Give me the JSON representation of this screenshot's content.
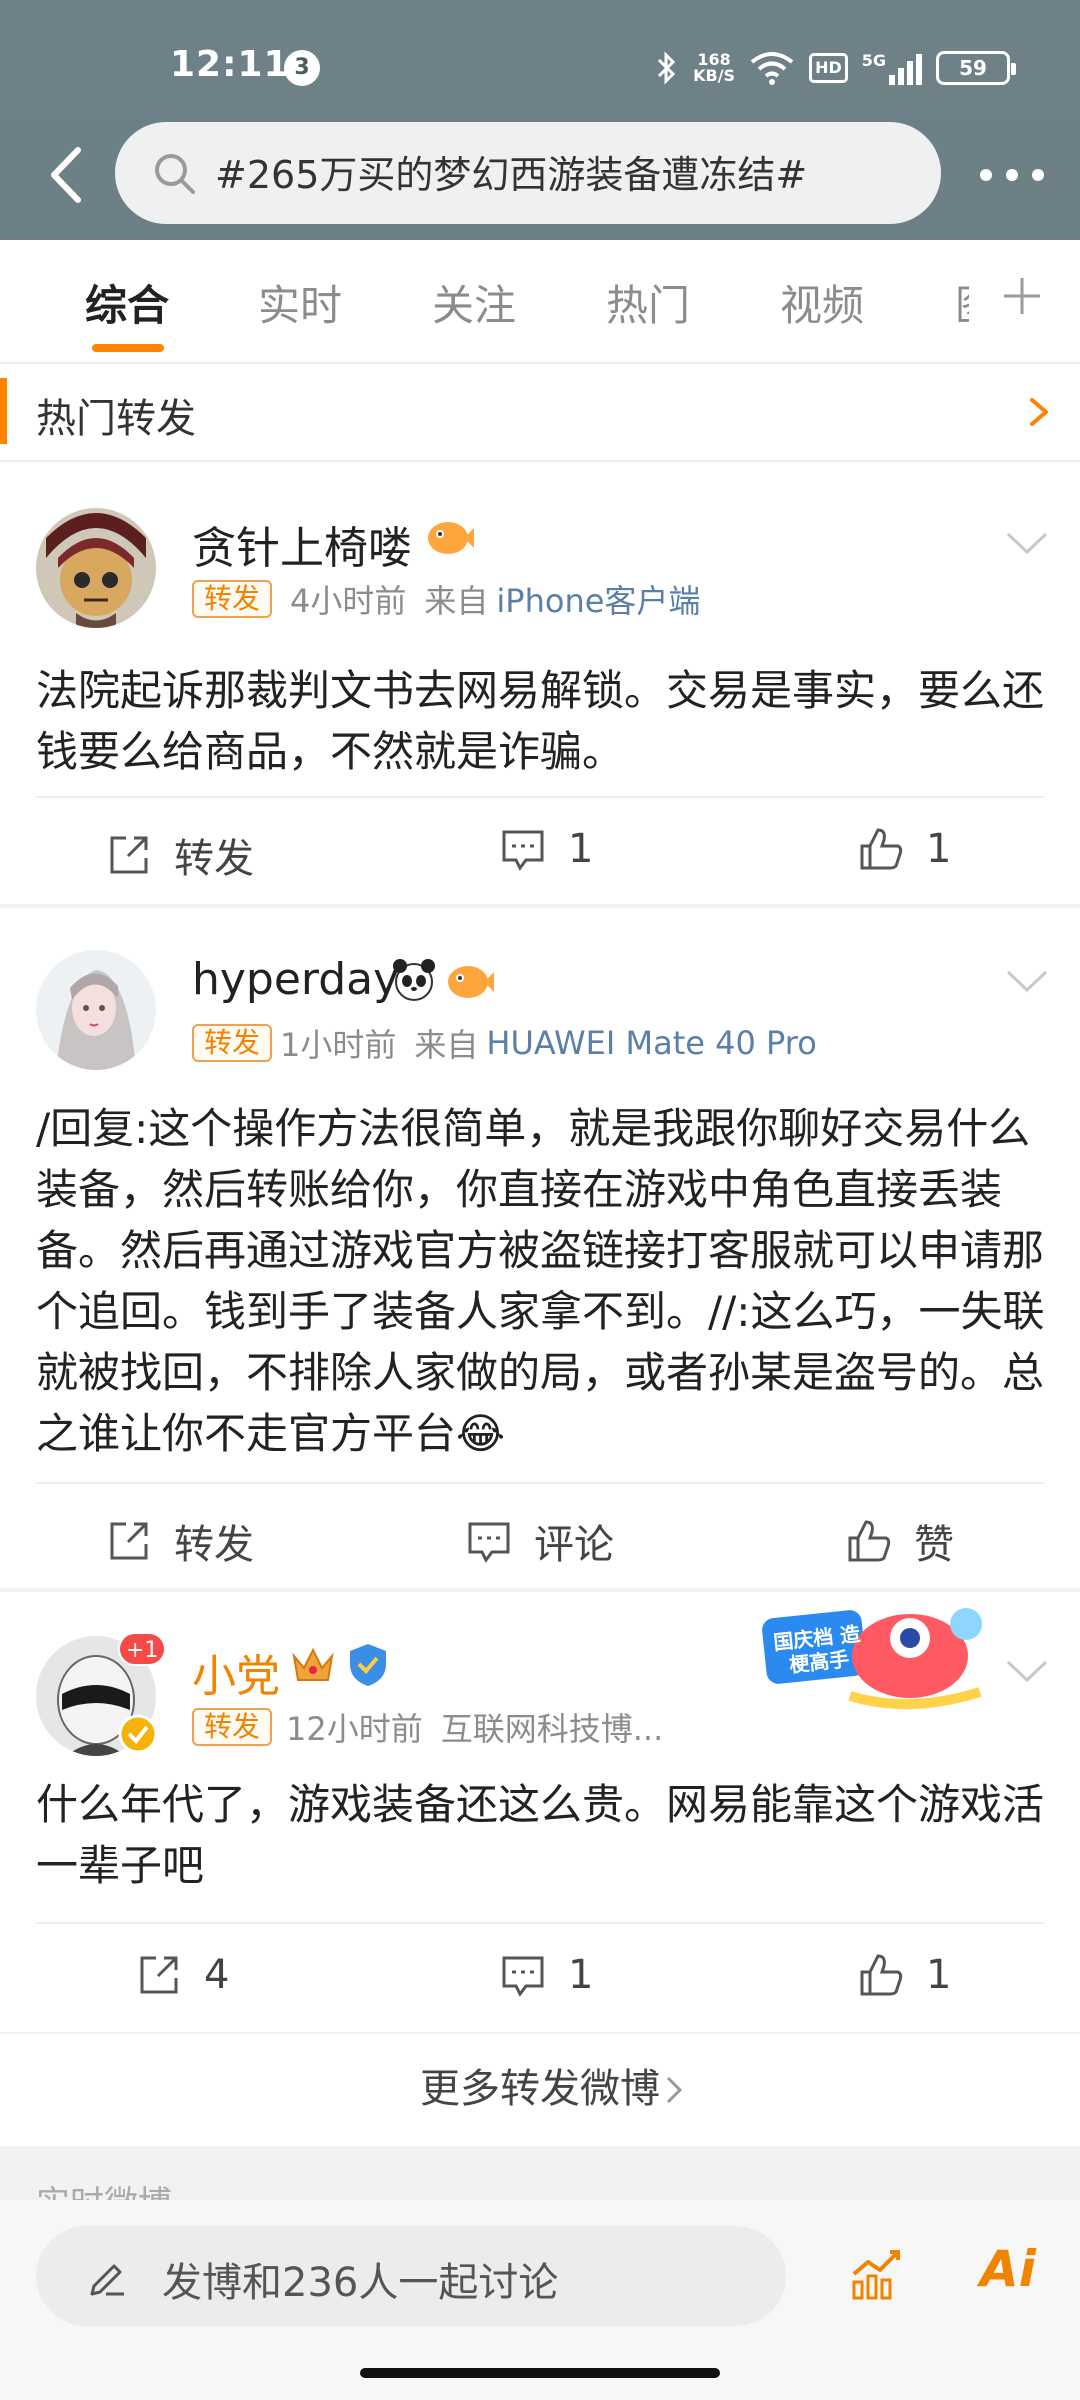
{
  "status_bar": {
    "time": "12:11",
    "notification_count": "3",
    "net_speed_value": "168",
    "net_speed_unit": "KB/S",
    "hd_label": "HD",
    "network": "5G",
    "battery": "59"
  },
  "search": {
    "query": "#265万买的梦幻西游装备遭冻结#"
  },
  "tabs": [
    {
      "label": "综合"
    },
    {
      "label": "实时"
    },
    {
      "label": "关注"
    },
    {
      "label": "热门"
    },
    {
      "label": "视频"
    },
    {
      "label": "图"
    }
  ],
  "section": {
    "title": "热门转发"
  },
  "posts": [
    {
      "username": "贪针上椅喽",
      "tag": "转发",
      "time": "4小时前",
      "source_prefix": "来自",
      "source": "iPhone客户端",
      "text": "法院起诉那裁判文书去网易解锁。交易是事实，要么还钱要么给商品，不然就是诈骗。",
      "repost_label": "转发",
      "comment_label": "1",
      "like_label": "1"
    },
    {
      "username": "hyperday",
      "tag": "转发",
      "time": "1小时前",
      "source_prefix": "来自",
      "source": "HUAWEI Mate 40 Pro",
      "text": "/回复:这个操作方法很简单，就是我跟你聊好交易什么装备，然后转账给你，你直接在游戏中角色直接丢装备。然后再通过游戏官方被盗链接打客服就可以申请那个追回。钱到手了装备人家拿不到。//:这么巧，一失联就被找回，不排除人家做的局，或者孙某是盗号的。总之谁让你不走官方平台😂",
      "repost_label": "转发",
      "comment_label": "评论",
      "like_label": "赞"
    },
    {
      "username": "小党",
      "avatar_badge": "+1",
      "tag": "转发",
      "time": "12小时前",
      "source": "互联网科技博...",
      "text": "什么年代了，游戏装备还这么贵。网易能靠这个游戏活一辈子吧",
      "repost_label": "4",
      "comment_label": "1",
      "like_label": "1",
      "promo_text": "国庆档 造梗高手"
    }
  ],
  "more_reposts": "更多转发微博",
  "next_section": "实时微博",
  "compose": {
    "placeholder": "发博和236人一起讨论"
  },
  "ai_label": "Ai",
  "colors": {
    "accent": "#ff8200",
    "header": "#6f8288",
    "link": "#5b7fa6"
  }
}
